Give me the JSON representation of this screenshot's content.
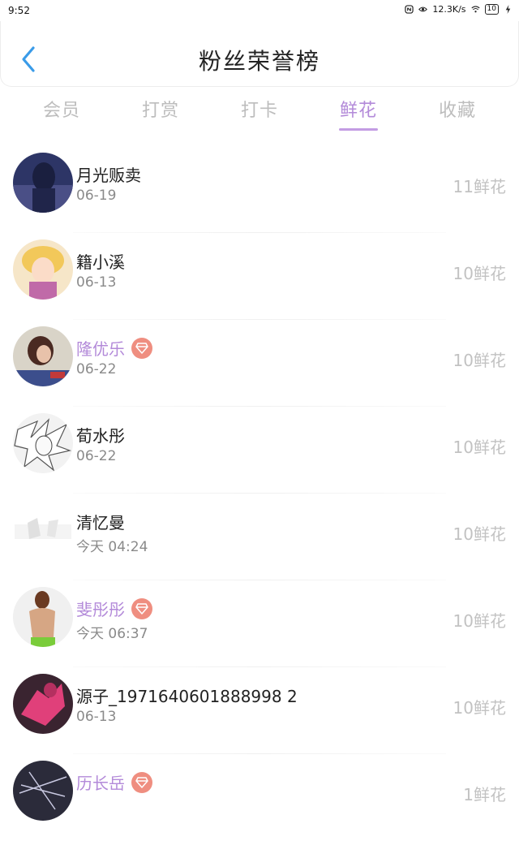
{
  "status_bar": {
    "time": "9:52",
    "speed": "12.3K/s",
    "battery": "10"
  },
  "header": {
    "title": "粉丝荣誉榜"
  },
  "tabs": [
    {
      "label": "会员"
    },
    {
      "label": "打赏"
    },
    {
      "label": "打卡"
    },
    {
      "label": "鲜花",
      "active": true
    },
    {
      "label": "收藏"
    }
  ],
  "rows": [
    {
      "name": "月光贩卖",
      "date": "06-19",
      "count": "11鲜花",
      "vip": false
    },
    {
      "name": "籍小溪",
      "date": "06-13",
      "count": "10鲜花",
      "vip": false
    },
    {
      "name": "隆优乐",
      "date": "06-22",
      "count": "10鲜花",
      "vip": true
    },
    {
      "name": "荀水彤",
      "date": "06-22",
      "count": "10鲜花",
      "vip": false
    },
    {
      "name": "清忆曼",
      "date": "今天 04:24",
      "count": "10鲜花",
      "vip": false
    },
    {
      "name": "斐彤彤",
      "date": "今天 06:37",
      "count": "10鲜花",
      "vip": true
    },
    {
      "name": "源子_1971640601888998 2",
      "date": "06-13",
      "count": "10鲜花",
      "vip": false
    },
    {
      "name": "历长岳",
      "date": "",
      "count": "1鲜花",
      "vip": true
    }
  ],
  "colors": {
    "accent": "#b38ad9",
    "badge": "#ef8e80",
    "back_arrow": "#3a9be8"
  }
}
